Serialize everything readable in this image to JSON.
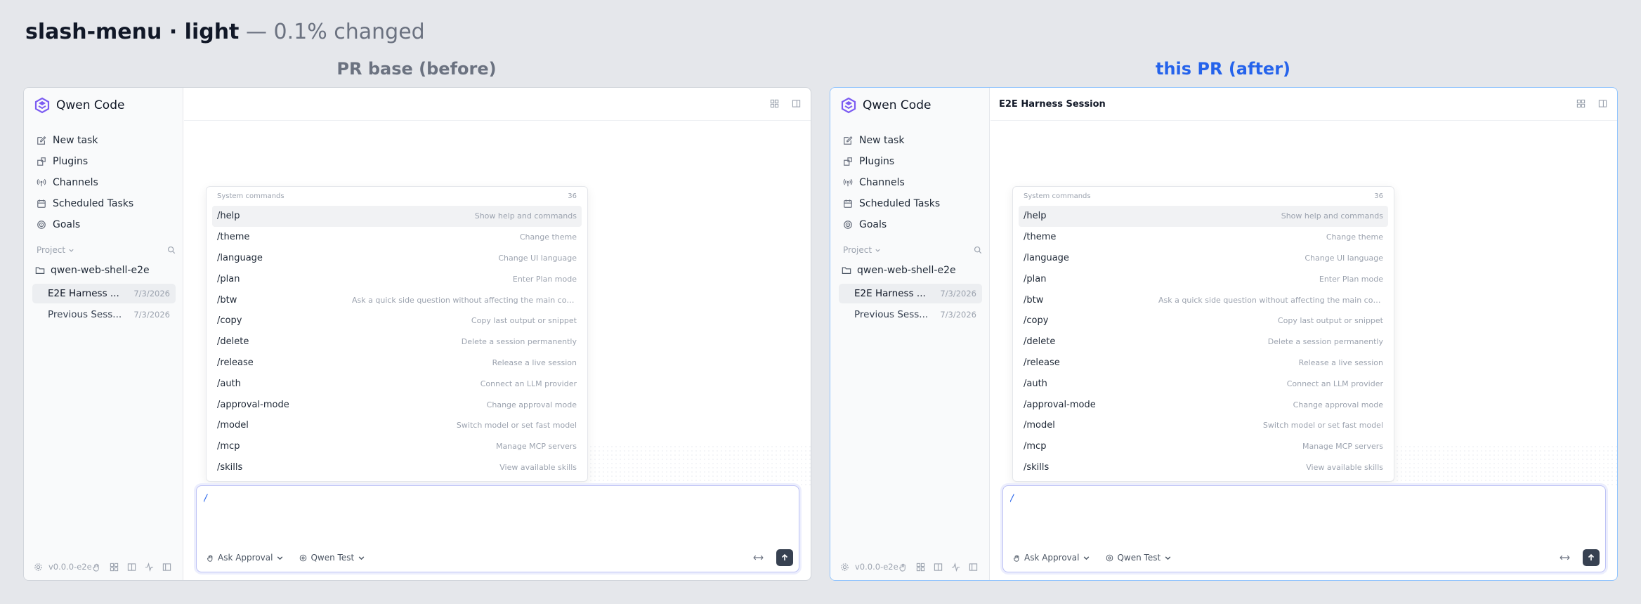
{
  "header": {
    "name": "slash-menu · light",
    "suffix": "— 0.1% changed"
  },
  "colors": {
    "before_label": "#6b7280",
    "after_label": "#2563eb",
    "accent": "#2563eb",
    "brand": "#7c5cf2"
  },
  "panes": [
    {
      "label": "PR base (before)",
      "app_name": "Qwen Code",
      "session_title": "",
      "nav": [
        "New task",
        "Plugins",
        "Channels",
        "Scheduled Tasks",
        "Goals"
      ],
      "project_label": "Project",
      "project_folder": "qwen-web-shell-e2e",
      "sessions": [
        {
          "title": "E2E Harness ...",
          "date": "7/3/2026"
        },
        {
          "title": "Previous Sess...",
          "date": "7/3/2026"
        }
      ],
      "version": "v0.0.0-e2e",
      "popup_heading": "System commands",
      "popup_count": "36",
      "commands": [
        {
          "name": "/help",
          "desc": "Show help and commands"
        },
        {
          "name": "/theme",
          "desc": "Change theme"
        },
        {
          "name": "/language",
          "desc": "Change UI language"
        },
        {
          "name": "/plan",
          "desc": "Enter Plan mode"
        },
        {
          "name": "/btw",
          "desc": "Ask a quick side question without affecting the main conversation"
        },
        {
          "name": "/copy",
          "desc": "Copy last output or snippet"
        },
        {
          "name": "/delete",
          "desc": "Delete a session permanently"
        },
        {
          "name": "/release",
          "desc": "Release a live session"
        },
        {
          "name": "/auth",
          "desc": "Connect an LLM provider"
        },
        {
          "name": "/approval-mode",
          "desc": "Change approval mode"
        },
        {
          "name": "/model",
          "desc": "Switch model or set fast model"
        },
        {
          "name": "/mcp",
          "desc": "Manage MCP servers"
        },
        {
          "name": "/skills",
          "desc": "View available skills"
        }
      ],
      "composer_value": "/",
      "approval": "Ask Approval",
      "model": "Qwen Test"
    },
    {
      "label": "this PR (after)",
      "app_name": "Qwen Code",
      "session_title": "E2E Harness Session",
      "nav": [
        "New task",
        "Plugins",
        "Channels",
        "Scheduled Tasks",
        "Goals"
      ],
      "project_label": "Project",
      "project_folder": "qwen-web-shell-e2e",
      "sessions": [
        {
          "title": "E2E Harness ...",
          "date": "7/3/2026"
        },
        {
          "title": "Previous Sess...",
          "date": "7/3/2026"
        }
      ],
      "version": "v0.0.0-e2e",
      "popup_heading": "System commands",
      "popup_count": "36",
      "commands": [
        {
          "name": "/help",
          "desc": "Show help and commands"
        },
        {
          "name": "/theme",
          "desc": "Change theme"
        },
        {
          "name": "/language",
          "desc": "Change UI language"
        },
        {
          "name": "/plan",
          "desc": "Enter Plan mode"
        },
        {
          "name": "/btw",
          "desc": "Ask a quick side question without affecting the main conversation"
        },
        {
          "name": "/copy",
          "desc": "Copy last output or snippet"
        },
        {
          "name": "/delete",
          "desc": "Delete a session permanently"
        },
        {
          "name": "/release",
          "desc": "Release a live session"
        },
        {
          "name": "/auth",
          "desc": "Connect an LLM provider"
        },
        {
          "name": "/approval-mode",
          "desc": "Change approval mode"
        },
        {
          "name": "/model",
          "desc": "Switch model or set fast model"
        },
        {
          "name": "/mcp",
          "desc": "Manage MCP servers"
        },
        {
          "name": "/skills",
          "desc": "View available skills"
        }
      ],
      "composer_value": "/",
      "approval": "Ask Approval",
      "model": "Qwen Test"
    }
  ]
}
